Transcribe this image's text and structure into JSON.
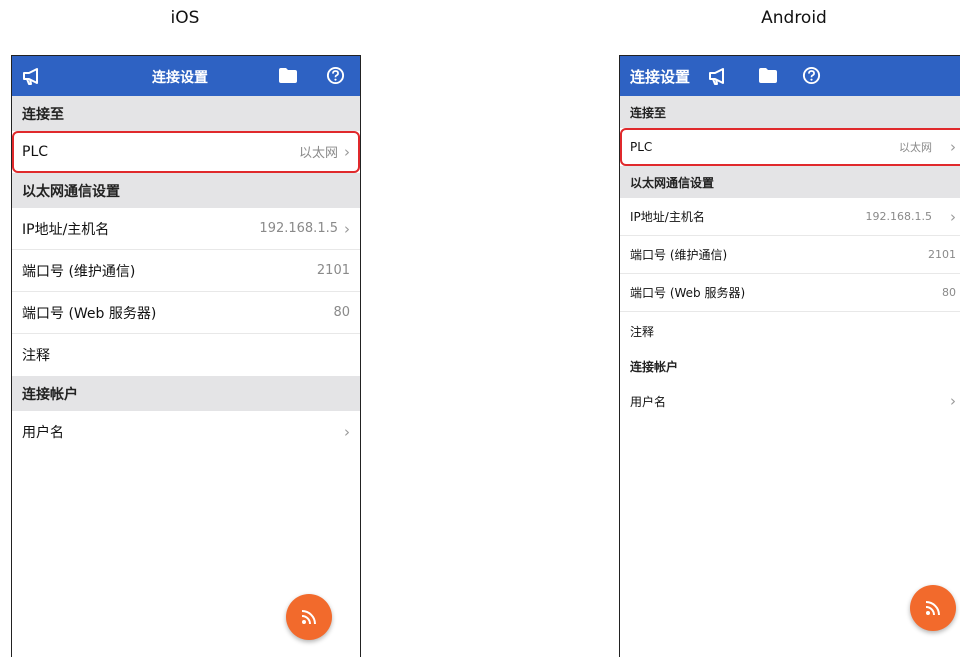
{
  "captions": {
    "ios": "iOS",
    "android": "Android"
  },
  "colors": {
    "appbar": "#2e62c3",
    "section": "#e4e4e6",
    "highlight": "#e0292c",
    "fab": "#f26a2c"
  },
  "ios": {
    "title": "连接设置",
    "icons": [
      "megaphone-icon",
      "folder-icon",
      "help-icon"
    ],
    "sections": {
      "connect_to": "连接至",
      "ethernet": "以太网通信设置",
      "account": "连接帐户"
    },
    "rows": {
      "plc": {
        "label": "PLC",
        "value": "以太网"
      },
      "ip": {
        "label": "IP地址/主机名",
        "value": "192.168.1.5"
      },
      "port_maint": {
        "label": "端口号 (维护通信)",
        "value": "2101"
      },
      "port_web": {
        "label": "端口号 (Web 服务器)",
        "value": "80"
      },
      "comment": {
        "label": "注释"
      },
      "username": {
        "label": "用户名"
      }
    },
    "fab_icon": "rss-icon"
  },
  "android": {
    "title": "连接设置",
    "icons": [
      "megaphone-icon",
      "folder-icon",
      "help-icon"
    ],
    "sections": {
      "connect_to": "连接至",
      "ethernet": "以太网通信设置",
      "account": "连接帐户"
    },
    "rows": {
      "plc": {
        "label": "PLC",
        "value": "以太网"
      },
      "ip": {
        "label": "IP地址/主机名",
        "value": "192.168.1.5"
      },
      "port_maint": {
        "label": "端口号 (维护通信)",
        "value": "2101"
      },
      "port_web": {
        "label": "端口号 (Web 服务器)",
        "value": "80"
      },
      "comment": {
        "label": "注释"
      },
      "username": {
        "label": "用户名"
      }
    },
    "fab_icon": "rss-icon"
  }
}
